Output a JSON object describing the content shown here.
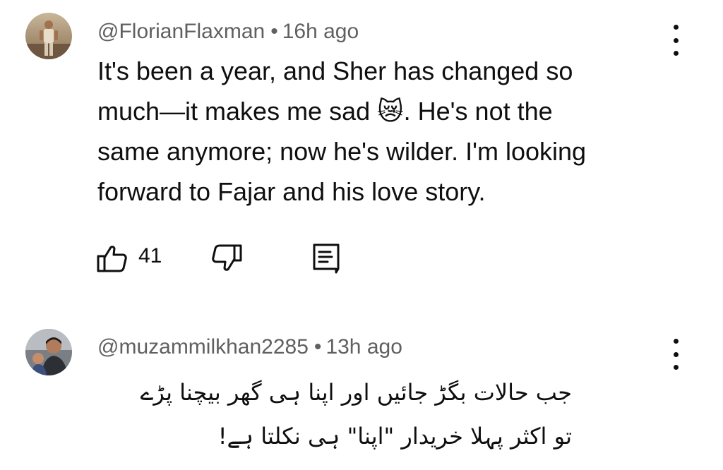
{
  "comments": [
    {
      "author": "@FlorianFlaxman",
      "separator": "•",
      "time": "16h ago",
      "lines": [
        "It's been a year, and Sher has changed so",
        "much—it makes me sad 😿. He's not the",
        "same anymore; now he's wilder. I'm looking",
        "forward to Fajar and his love story."
      ],
      "likes": "41",
      "icons": {
        "like": "thumb-up-icon",
        "dislike": "thumb-down-icon",
        "reply": "reply-comment-icon",
        "more": "more-vertical-icon"
      }
    },
    {
      "author": "@muzammilkhan2285",
      "separator": "•",
      "time": "13h ago",
      "lines": [
        "جب حالات بگڑ جائیں اور اپنا ہی گھر بیچنا پڑے",
        "تو اکثر پہلا خریدار \"اپنا\" ہی نکلتا ہے!"
      ],
      "icons": {
        "more": "more-vertical-icon"
      }
    }
  ]
}
